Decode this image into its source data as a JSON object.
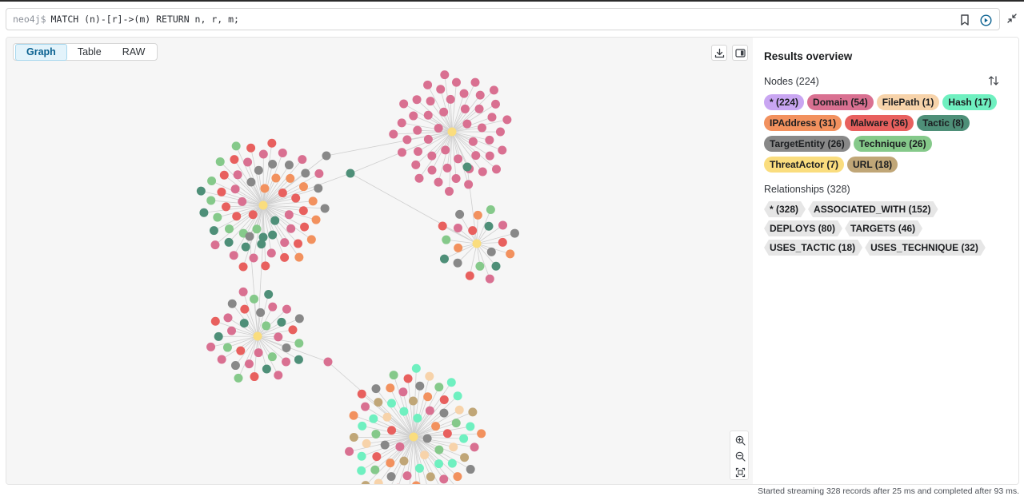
{
  "editor": {
    "prompt": "neo4j$",
    "query": "MATCH (n)-[r]->(m) RETURN n, r, m;"
  },
  "view_tabs": [
    {
      "label": "Graph",
      "active": true
    },
    {
      "label": "Table",
      "active": false
    },
    {
      "label": "RAW",
      "active": false
    }
  ],
  "panel": {
    "title": "Results overview",
    "nodes_label": "Nodes (224)",
    "relationships_label": "Relationships (328)",
    "node_chips": [
      {
        "label": "* (224)",
        "color": "#c9a6f2"
      },
      {
        "label": "Domain (54)",
        "color": "#d97091"
      },
      {
        "label": "FilePath (1)",
        "color": "#f7d3aa"
      },
      {
        "label": "Hash (17)",
        "color": "#6ff0c0"
      },
      {
        "label": "IPAddress (31)",
        "color": "#f2915e"
      },
      {
        "label": "Malware (36)",
        "color": "#e8605e"
      },
      {
        "label": "Tactic (8)",
        "color": "#4e8f78"
      },
      {
        "label": "TargetEntity (26)",
        "color": "#888888"
      },
      {
        "label": "Technique (26)",
        "color": "#85c98a"
      },
      {
        "label": "ThreatActor (7)",
        "color": "#fadd7e"
      },
      {
        "label": "URL (18)",
        "color": "#c0a677"
      }
    ],
    "relationship_chips": [
      {
        "label": "* (328)"
      },
      {
        "label": "ASSOCIATED_WITH (152)"
      },
      {
        "label": "DEPLOYS (80)"
      },
      {
        "label": "TARGETS (46)"
      },
      {
        "label": "USES_TACTIC (18)"
      },
      {
        "label": "USES_TECHNIQUE (32)"
      }
    ]
  },
  "status": "Started streaming 328 records after 25 ms and completed after 93 ms.",
  "graph": {
    "colors": {
      "domain": "#d97091",
      "filepath": "#f7d3aa",
      "hash": "#6ff0c0",
      "ipaddress": "#f2915e",
      "malware": "#e8605e",
      "tactic": "#4e8f78",
      "targetentity": "#888888",
      "technique": "#85c98a",
      "threatactor": "#fadd7e",
      "url": "#c0a677"
    },
    "clusters": [
      {
        "palette": [
          "malware",
          "domain",
          "targetentity",
          "technique",
          "malware",
          "domain",
          "tactic",
          "ipaddress"
        ],
        "count": 62
      },
      {
        "palette": [
          "ipaddress",
          "domain",
          "technique",
          "malware",
          "targetentity",
          "ipaddress",
          "tactic"
        ],
        "count": 50
      },
      {
        "palette": [
          "technique",
          "domain",
          "malware",
          "targetentity",
          "ipaddress",
          "tactic"
        ],
        "count": 20
      },
      {
        "palette": [
          "domain",
          "malware",
          "targetentity",
          "technique",
          "domain",
          "tactic"
        ],
        "count": 34
      },
      {
        "palette": [
          "hash",
          "url",
          "domain",
          "ipaddress",
          "targetentity",
          "malware",
          "technique",
          "filepath",
          "hash"
        ],
        "count": 72
      }
    ]
  }
}
